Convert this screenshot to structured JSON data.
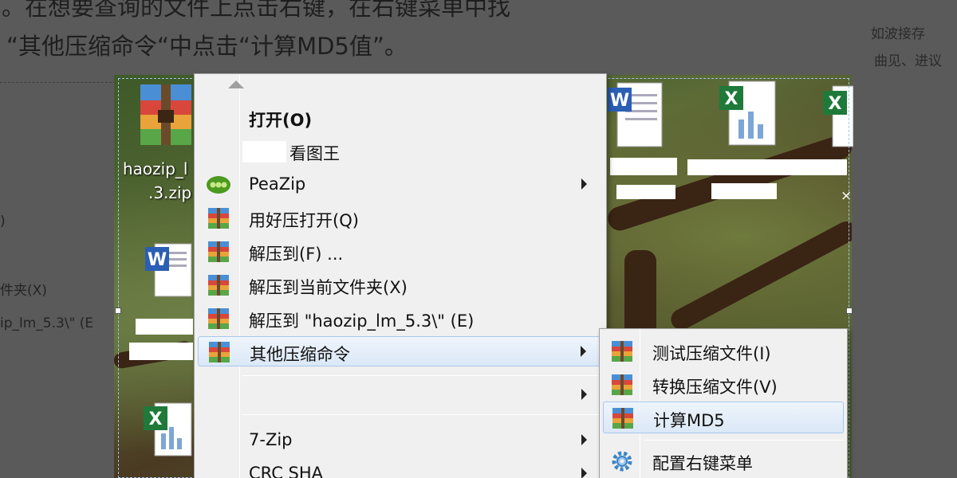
{
  "article": {
    "line1": "。在想要查询的文件上点击右键，在右键菜单中找",
    "line2": "“其他压缩命令“中点击“计算MD5值”。",
    "side_line1": "如波接存",
    "side_line2": "曲见、进议",
    "left_frag1": "件夹(X)",
    "left_frag2": "ip_lm_5.3\\\" (E"
  },
  "desktop": {
    "icon_caption_line1": "haozip_l",
    "icon_caption_line2": ".3.zip",
    "close_glyph": "×"
  },
  "context_menu": {
    "items": [
      {
        "label": "打开(O)",
        "bold": true,
        "icon": "",
        "submenu": false
      },
      {
        "label": "看图王",
        "bold": false,
        "icon": "masked",
        "submenu": false
      },
      {
        "label": "PeaZip",
        "bold": false,
        "icon": "peazip-icon",
        "submenu": true
      },
      {
        "label": "用好压打开(Q)",
        "bold": false,
        "icon": "haozip-icon",
        "submenu": false
      },
      {
        "label": "解压到(F) ...",
        "bold": false,
        "icon": "haozip-icon",
        "submenu": false
      },
      {
        "label": "解压到当前文件夹(X)",
        "bold": false,
        "icon": "haozip-icon",
        "submenu": false
      },
      {
        "label": "解压到 \"haozip_lm_5.3\\\" (E)",
        "bold": false,
        "icon": "haozip-icon",
        "submenu": false
      },
      {
        "label": "其他压缩命令",
        "bold": false,
        "icon": "haozip-icon",
        "submenu": true
      },
      {
        "label": "",
        "bold": false,
        "icon": "",
        "submenu": true
      },
      {
        "label": "7-Zip",
        "bold": false,
        "icon": "",
        "submenu": true
      },
      {
        "label": "CRC SHA",
        "bold": false,
        "icon": "",
        "submenu": true
      }
    ]
  },
  "submenu": {
    "items": [
      {
        "label": "测试压缩文件(I)",
        "icon": "haozip-icon"
      },
      {
        "label": "转换压缩文件(V)",
        "icon": "haozip-icon"
      },
      {
        "label": "计算MD5",
        "icon": "haozip-icon"
      },
      {
        "label": "配置右键菜单",
        "icon": "gear-icon"
      }
    ]
  },
  "colors": {
    "overlay": "#5a5a5a",
    "menu_bg": "#f0f0f0",
    "hover_border": "#a8c8ec",
    "selection_dash": "#9fc5e8"
  }
}
